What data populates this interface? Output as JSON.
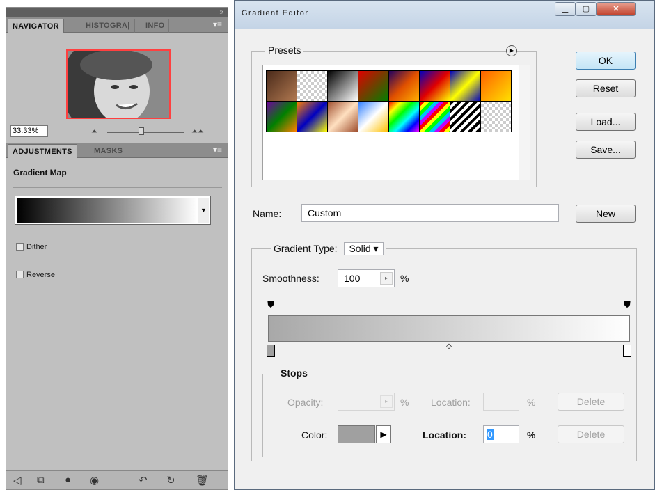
{
  "left_panel": {
    "collapse_glyph": "»",
    "top_tabs": [
      "NAVIGATOR",
      "HISTOGRA|",
      "INFO"
    ],
    "zoom_value": "33.33%",
    "adj_tabs": [
      "ADJUSTMENTS",
      "MASKS"
    ],
    "section_title": "Gradient Map",
    "dither_label": "Dither",
    "reverse_label": "Reverse",
    "bottom_icons": [
      "back-arrow-icon",
      "clip-icon",
      "mask-icon",
      "eye-icon",
      "view-previous-icon",
      "reset-icon",
      "trash-icon"
    ]
  },
  "dialog": {
    "title": "Gradient Editor",
    "presets_label": "Presets",
    "ok": "OK",
    "reset": "Reset",
    "load": "Load...",
    "save": "Save...",
    "name_label": "Name:",
    "name_value": "Custom",
    "new_btn": "New",
    "gradient_type_label": "Gradient Type:",
    "gradient_type_value": "Solid",
    "smoothness_label": "Smoothness:",
    "smoothness_value": "100",
    "percent": "%",
    "stops_label": "Stops",
    "opacity_label": "Opacity:",
    "location_label": "Location:",
    "color_label": "Color:",
    "location_value": "0",
    "delete_btn": "Delete"
  },
  "colors": {
    "gradient_start": "#a8a8a8",
    "gradient_end": "#ffffff",
    "stop_color": "#a0a0a0"
  }
}
